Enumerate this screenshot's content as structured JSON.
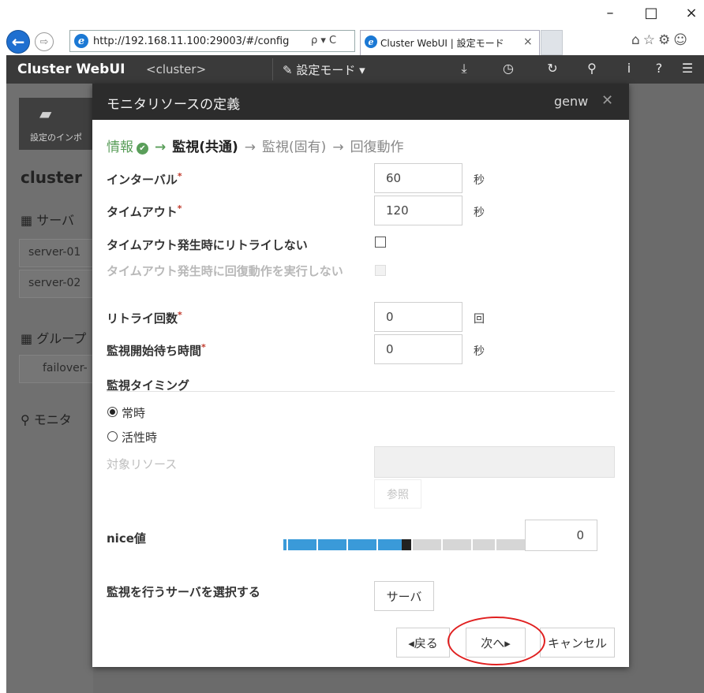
{
  "browser": {
    "window_controls": {
      "minimize": "–",
      "maximize": "□",
      "close": "×"
    },
    "nav": {
      "back_icon": "←",
      "forward_icon": "⇨"
    },
    "address": {
      "url": "http://192.168.11.100:29003/#/config",
      "tools": "ρ ▾ C"
    },
    "tab": {
      "title": "Cluster WebUI | 設定モード",
      "close": "×"
    },
    "toolbar_icons": "⌂☆⚙☺"
  },
  "app": {
    "title": "Cluster WebUI",
    "cluster": "<cluster>",
    "mode_menu": "✎ 設定モード ▾",
    "icons": [
      "⤓",
      "◷",
      "↻",
      "⚲",
      "i",
      "?",
      "☰"
    ]
  },
  "background": {
    "card_label": "設定のインポ",
    "cluster_name": "cluster",
    "servers_heading": "▦ サーバ",
    "servers": [
      "server-01",
      "server-02"
    ],
    "groups_heading": "▦ グループ",
    "group_item": "failover-",
    "monitor_heading": "⚲ モニタ"
  },
  "modal": {
    "title": "モニタリソースの定義",
    "user": "genw",
    "close": "✕",
    "steps": [
      {
        "label": "情報",
        "state": "done"
      },
      {
        "label": "監視(共通)",
        "state": "current"
      },
      {
        "label": "監視(固有)",
        "state": "next"
      },
      {
        "label": "回復動作",
        "state": "next"
      }
    ],
    "step_arrow": "→",
    "fields": {
      "interval": {
        "label": "インターバル",
        "required": "*",
        "value": "60",
        "unit": "秒"
      },
      "timeout": {
        "label": "タイムアウト",
        "required": "*",
        "value": "120",
        "unit": "秒"
      },
      "no_retry_on_timeout": {
        "label": "タイムアウト発生時にリトライしない",
        "checked": false
      },
      "no_recovery_on_timeout": {
        "label": "タイムアウト発生時に回復動作を実行しない",
        "checked": false,
        "disabled": true
      },
      "retry_count": {
        "label": "リトライ回数",
        "required": "*",
        "value": "0",
        "unit": "回"
      },
      "wait_time": {
        "label": "監視開始待ち時間",
        "required": "*",
        "value": "0",
        "unit": "秒"
      }
    },
    "timing": {
      "heading": "監視タイミング",
      "options": [
        {
          "label": "常時",
          "selected": true
        },
        {
          "label": "活性時",
          "selected": false
        }
      ],
      "target_label": "対象リソース",
      "browse_label": "参照"
    },
    "nice": {
      "label": "nice値",
      "value": "0",
      "slider_fraction": 0.5
    },
    "servers": {
      "label": "監視を行うサーバを選択する",
      "button": "サーバ"
    },
    "footer": {
      "back": "◂戻る",
      "next": "次へ▸",
      "cancel": "キャンセル"
    },
    "colors": {
      "slider_fill": "#3a9ad9",
      "slider_empty": "#d6d6d6",
      "header": "#2c2c2c",
      "done_step": "#5a9e5a",
      "highlight": "#e02020"
    }
  }
}
